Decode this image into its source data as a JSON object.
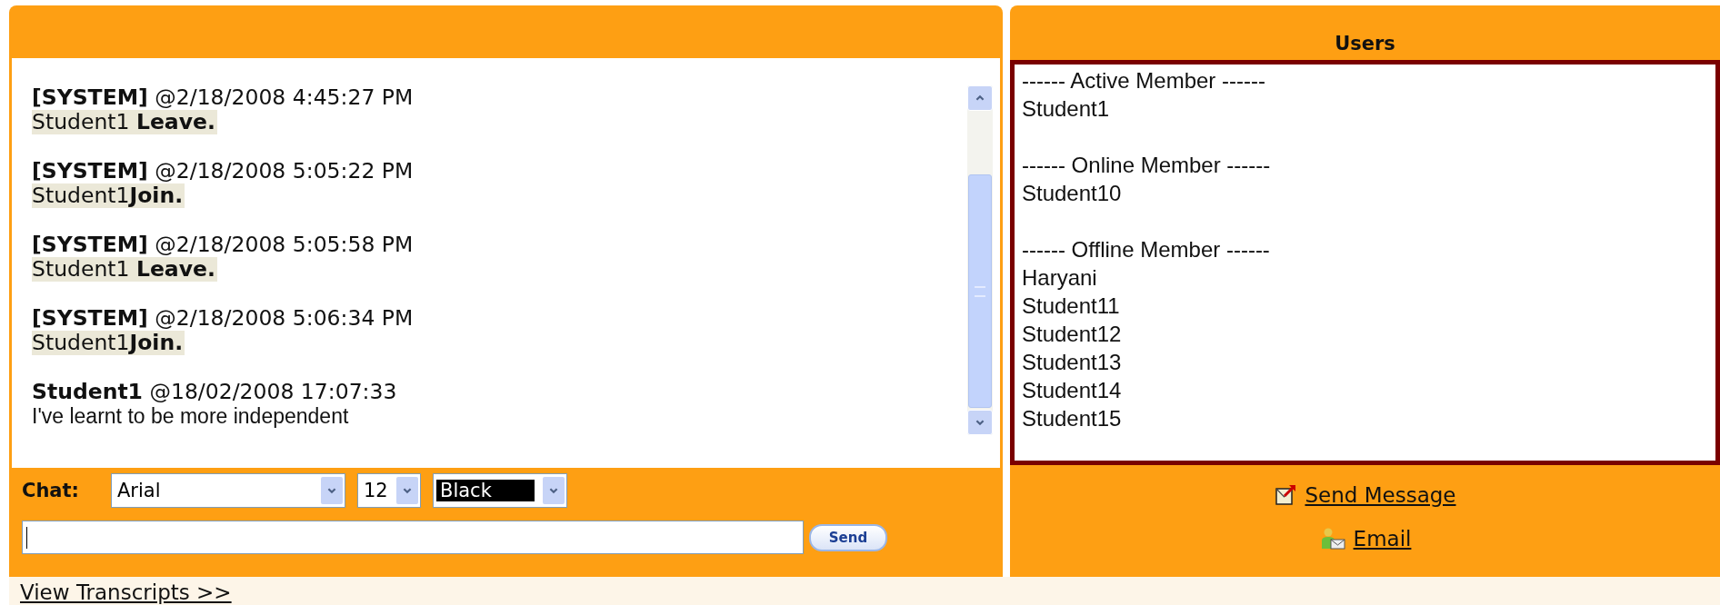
{
  "chat_panel": {
    "messages": [
      {
        "kind": "system",
        "sender": "[SYSTEM]",
        "time": "@2/18/2008 4:45:27 PM",
        "text": "Student1 **Leave.**"
      },
      {
        "kind": "system",
        "sender": "[SYSTEM]",
        "time": "@2/18/2008 5:05:22 PM",
        "text": "Student1**Join.**"
      },
      {
        "kind": "system",
        "sender": "[SYSTEM]",
        "time": "@2/18/2008 5:05:58 PM",
        "text": "Student1 **Leave.**"
      },
      {
        "kind": "system",
        "sender": "[SYSTEM]",
        "time": "@2/18/2008 5:06:34 PM",
        "text": "Student1**Join.**"
      },
      {
        "kind": "user",
        "sender": "Student1",
        "time": "@18/02/2008 17:07:33",
        "text": "I've learnt to be more independent"
      }
    ]
  },
  "chat_bar": {
    "label": "Chat:",
    "font_select": "Arial",
    "size_select": "12",
    "color_select": "Black",
    "send_button": "Send"
  },
  "users_panel": {
    "title": "Users",
    "groups": [
      {
        "heading": "------ Active Member ------",
        "members": [
          "Student1"
        ]
      },
      {
        "heading": "------ Online Member ------",
        "members": [
          "Student10"
        ]
      },
      {
        "heading": "------ Offline Member ------",
        "members": [
          "Haryani",
          "Student11",
          "Student12",
          "Student13",
          "Student14",
          "Student15"
        ]
      }
    ]
  },
  "actions": [
    {
      "kind": "message",
      "label": "Send Message"
    },
    {
      "kind": "email",
      "label": "Email"
    }
  ],
  "footer_link": "View Transcripts >>"
}
